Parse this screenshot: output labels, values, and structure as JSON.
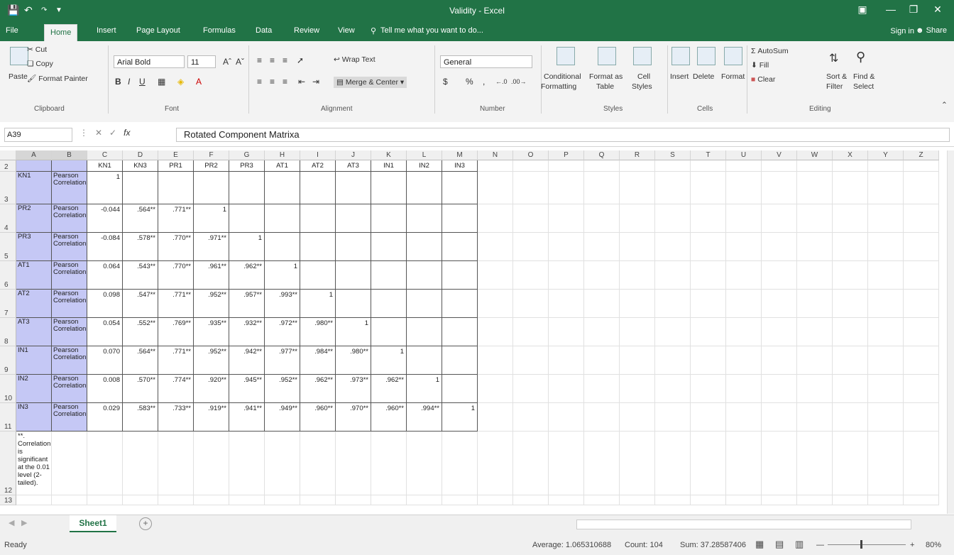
{
  "window": {
    "title": "Validity - Excel"
  },
  "tabs": [
    "File",
    "Home",
    "Insert",
    "Page Layout",
    "Formulas",
    "Data",
    "Review",
    "View"
  ],
  "active_tab": "Home",
  "tell_me": "Tell me what you want to do...",
  "signin": "Sign in",
  "share": "Share",
  "ribbon": {
    "clipboard": {
      "paste": "Paste",
      "cut": "Cut",
      "copy": "Copy",
      "format_painter": "Format Painter",
      "label": "Clipboard"
    },
    "font": {
      "name": "Arial Bold",
      "size": "11",
      "label": "Font"
    },
    "alignment": {
      "wrap": "Wrap Text",
      "merge": "Merge & Center",
      "label": "Alignment"
    },
    "number": {
      "format": "General",
      "label": "Number",
      "currency": "$",
      "percent": "%",
      "comma": ","
    },
    "styles": {
      "cond": "Conditional",
      "cond2": "Formatting",
      "fmt": "Format as",
      "fmt2": "Table",
      "cell": "Cell",
      "cell2": "Styles",
      "label": "Styles"
    },
    "cells": {
      "insert": "Insert",
      "delete": "Delete",
      "format": "Format",
      "label": "Cells"
    },
    "editing": {
      "autosum": "AutoSum",
      "fill": "Fill",
      "clear": "Clear",
      "sort": "Sort &",
      "sort2": "Filter",
      "find": "Find &",
      "find2": "Select",
      "label": "Editing"
    }
  },
  "formula_bar": {
    "name_box": "A39",
    "fx": "fx",
    "content": "Rotated Component Matrixa"
  },
  "columns": [
    "A",
    "B",
    "C",
    "D",
    "E",
    "F",
    "G",
    "H",
    "I",
    "J",
    "K",
    "L",
    "M",
    "N",
    "O",
    "P",
    "Q",
    "R",
    "S",
    "T",
    "U",
    "V",
    "W",
    "X",
    "Y",
    "Z"
  ],
  "header_row": {
    "row": "2",
    "cells": [
      "",
      "",
      "KN1",
      "KN3",
      "PR1",
      "PR2",
      "PR3",
      "AT1",
      "AT2",
      "AT3",
      "IN1",
      "IN2",
      "IN3"
    ]
  },
  "rows": [
    {
      "num": "3",
      "label": "KN1",
      "type": "Pearson Correlation",
      "vals": [
        "1",
        "",
        "",
        "",
        "",
        "",
        "",
        "",
        "",
        "",
        ""
      ]
    },
    {
      "num": "4",
      "label": "PR2",
      "type": "Pearson Correlation",
      "vals": [
        "-0.044",
        ".564**",
        ".771**",
        "1",
        "",
        "",
        "",
        "",
        "",
        "",
        ""
      ]
    },
    {
      "num": "5",
      "label": "PR3",
      "type": "Pearson Correlation",
      "vals": [
        "-0.084",
        ".578**",
        ".770**",
        ".971**",
        "1",
        "",
        "",
        "",
        "",
        "",
        ""
      ]
    },
    {
      "num": "6",
      "label": "AT1",
      "type": "Pearson Correlation",
      "vals": [
        "0.064",
        ".543**",
        ".770**",
        ".961**",
        ".962**",
        "1",
        "",
        "",
        "",
        "",
        ""
      ]
    },
    {
      "num": "7",
      "label": "AT2",
      "type": "Pearson Correlation",
      "vals": [
        "0.098",
        ".547**",
        ".771**",
        ".952**",
        ".957**",
        ".993**",
        "1",
        "",
        "",
        "",
        ""
      ]
    },
    {
      "num": "8",
      "label": "AT3",
      "type": "Pearson Correlation",
      "vals": [
        "0.054",
        ".552**",
        ".769**",
        ".935**",
        ".932**",
        ".972**",
        ".980**",
        "1",
        "",
        "",
        ""
      ]
    },
    {
      "num": "9",
      "label": "IN1",
      "type": "Pearson Correlation",
      "vals": [
        "0.070",
        ".564**",
        ".771**",
        ".952**",
        ".942**",
        ".977**",
        ".984**",
        ".980**",
        "1",
        "",
        ""
      ]
    },
    {
      "num": "10",
      "label": "IN2",
      "type": "Pearson Correlation",
      "vals": [
        "0.008",
        ".570**",
        ".774**",
        ".920**",
        ".945**",
        ".952**",
        ".962**",
        ".973**",
        ".962**",
        "1",
        ""
      ]
    },
    {
      "num": "11",
      "label": "IN3",
      "type": "Pearson Correlation",
      "vals": [
        "0.029",
        ".583**",
        ".733**",
        ".919**",
        ".941**",
        ".949**",
        ".960**",
        ".970**",
        ".960**",
        ".994**",
        "1"
      ]
    }
  ],
  "footnote": {
    "num": "12",
    "text": "**. Correlation is significant at the 0.01 level (2-tailed)."
  },
  "row13": "13",
  "sheet_tab": "Sheet1",
  "status": {
    "ready": "Ready",
    "average": "Average: 1.065310688",
    "count": "Count: 104",
    "sum": "Sum: 37.28587406",
    "zoom": "80%"
  },
  "colors": {
    "accent": "#217346",
    "selection": "#c5c8f5"
  }
}
